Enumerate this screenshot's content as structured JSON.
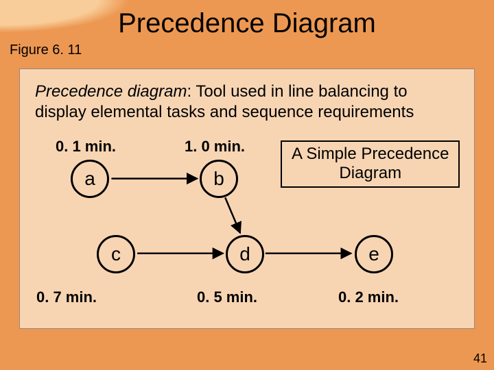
{
  "title": "Precedence Diagram",
  "figure_label": "Figure 6. 11",
  "definition": {
    "term": "Precedence diagram",
    "rest": ": Tool used in line balancing to display elemental tasks and sequence requirements"
  },
  "box_label": {
    "line1": "A Simple Precedence",
    "line2": "Diagram"
  },
  "nodes": {
    "a": {
      "label": "a",
      "time": "0. 1 min."
    },
    "b": {
      "label": "b",
      "time": "1. 0 min."
    },
    "c": {
      "label": "c",
      "time": "0. 7 min."
    },
    "d": {
      "label": "d",
      "time": "0. 5 min."
    },
    "e": {
      "label": "e",
      "time": "0. 2 min."
    }
  },
  "edges": [
    {
      "from": "a",
      "to": "b"
    },
    {
      "from": "c",
      "to": "d"
    },
    {
      "from": "b",
      "to": "d"
    },
    {
      "from": "d",
      "to": "e"
    }
  ],
  "page_number": "41"
}
